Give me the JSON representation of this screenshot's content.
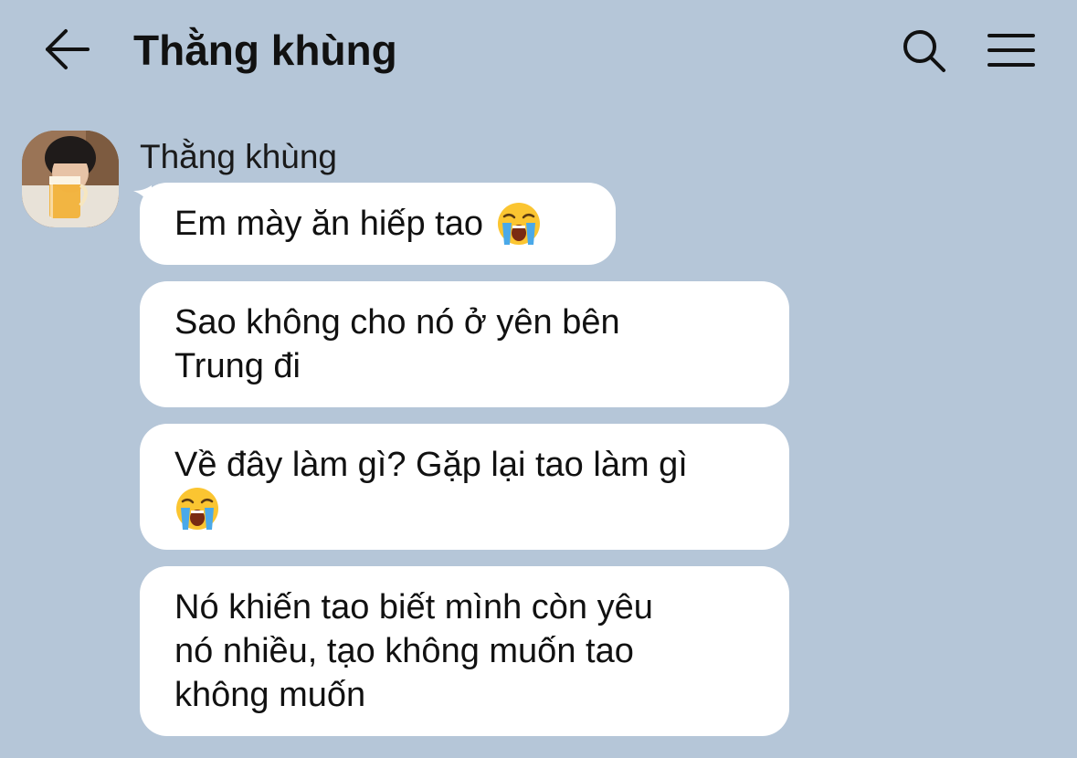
{
  "header": {
    "back_icon": "arrow-left-icon",
    "title": "Thằng khùng",
    "search_icon": "search-icon",
    "menu_icon": "hamburger-menu-icon"
  },
  "chat": {
    "sender": {
      "name": "Thằng khùng",
      "avatar": "avatar-photo"
    },
    "messages": [
      {
        "lines": [
          "Em mày ăn hiếp tao"
        ],
        "emoji_after": "loudly-crying-face"
      },
      {
        "lines": [
          "Sao không cho nó ở yên bên",
          "Trung đi"
        ]
      },
      {
        "lines": [
          "Về đây làm gì? Gặp lại tao làm gì"
        ],
        "emoji_line": "loudly-crying-face"
      },
      {
        "lines": [
          "Nó khiến tao biết mình còn yêu",
          "nó nhiều, tạo không muốn tao",
          "không muốn"
        ]
      }
    ]
  },
  "colors": {
    "background": "#b5c6d8",
    "bubble": "#ffffff",
    "text": "#111111"
  }
}
